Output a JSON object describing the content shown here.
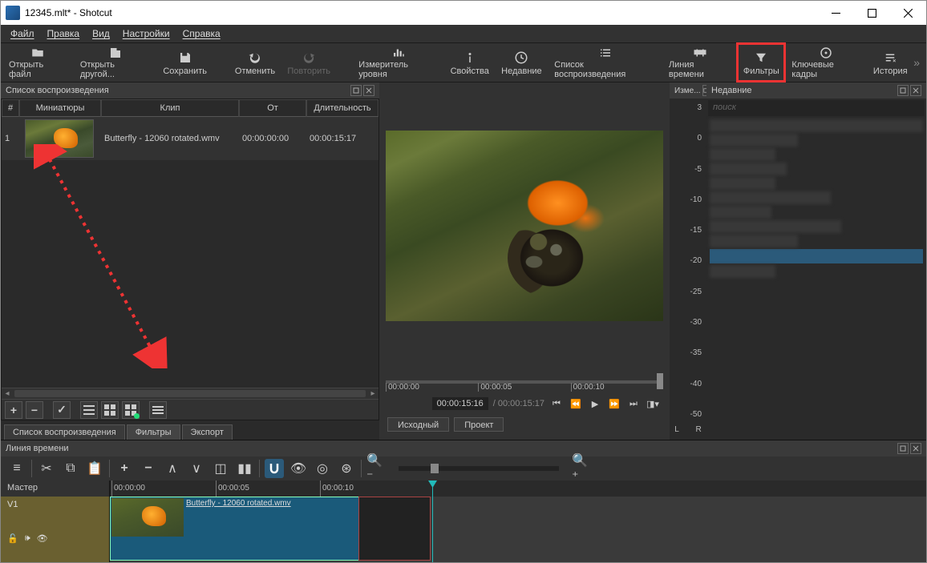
{
  "window": {
    "title": "12345.mlt* - Shotcut"
  },
  "menu": [
    "Файл",
    "Правка",
    "Вид",
    "Настройки",
    "Справка"
  ],
  "toolbar": [
    {
      "id": "open-file",
      "label": "Открыть файл"
    },
    {
      "id": "open-other",
      "label": "Открыть другой..."
    },
    {
      "id": "save",
      "label": "Сохранить"
    },
    {
      "id": "undo",
      "label": "Отменить"
    },
    {
      "id": "redo",
      "label": "Повторить",
      "disabled": true
    },
    {
      "id": "peak-meter",
      "label": "Измеритель уровня"
    },
    {
      "id": "properties",
      "label": "Свойства"
    },
    {
      "id": "recent",
      "label": "Недавние"
    },
    {
      "id": "playlist",
      "label": "Список воспроизведения"
    },
    {
      "id": "timeline",
      "label": "Линия времени"
    },
    {
      "id": "filters",
      "label": "Фильтры",
      "highlight": true
    },
    {
      "id": "keyframes",
      "label": "Ключевые кадры"
    },
    {
      "id": "history",
      "label": "История"
    }
  ],
  "playlist": {
    "title": "Список воспроизведения",
    "cols": {
      "num": "#",
      "thumb": "Миниатюры",
      "clip": "Клип",
      "from": "От",
      "dur": "Длительность"
    },
    "rows": [
      {
        "num": "1",
        "clip": "Butterfly - 12060 rotated.wmv",
        "from": "00:00:00:00",
        "dur": "00:00:15:17"
      }
    ],
    "tabs": [
      "Список воспроизведения",
      "Фильтры",
      "Экспорт"
    ],
    "active_tab": 1
  },
  "player": {
    "ticks": [
      "00:00:00",
      "00:00:05",
      "00:00:10"
    ],
    "current_tc": "00:00:15:16",
    "total_tc": "00:00:15:17",
    "tabs": {
      "source": "Исходный",
      "project": "Проект"
    }
  },
  "meter": {
    "title": "Изме...",
    "scale": [
      "3",
      "0",
      "-5",
      "-10",
      "-15",
      "-20",
      "-25",
      "-30",
      "-35",
      "-40",
      "-50"
    ],
    "lr": [
      "L",
      "R"
    ]
  },
  "recent": {
    "title": "Недавние",
    "search_ph": "поиск"
  },
  "timeline": {
    "title": "Линия времени",
    "master": "Мастер",
    "track": "V1",
    "ruler": [
      "00:00:00",
      "00:00:05",
      "00:00:10"
    ],
    "clip_label": "Butterfly - 12060 rotated.wmv"
  }
}
